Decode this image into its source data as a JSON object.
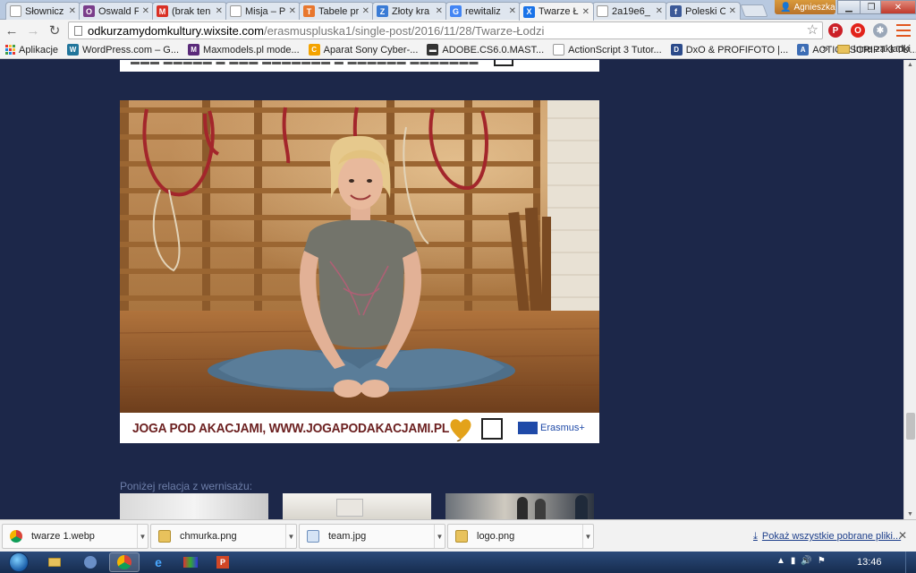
{
  "browser": {
    "tabs": [
      {
        "label": "Słownicz",
        "color": "#ffffff",
        "glyph": ""
      },
      {
        "label": "Oswald F",
        "color": "#7a3d8a",
        "glyph": "O"
      },
      {
        "label": "(brak ten",
        "color": "#d93025",
        "glyph": "M"
      },
      {
        "label": "Misja – P",
        "color": "#ffffff",
        "glyph": ""
      },
      {
        "label": "Tabele pr",
        "color": "#e8772e",
        "glyph": "T"
      },
      {
        "label": "Złoty kra",
        "color": "#3a7bd5",
        "glyph": "Z"
      },
      {
        "label": "rewitaliz",
        "color": "#4285f4",
        "glyph": "G"
      },
      {
        "label": "Twarze Ł",
        "color": "#1a73e8",
        "glyph": "X"
      },
      {
        "label": "2a19e6_",
        "color": "#ffffff",
        "glyph": ""
      },
      {
        "label": "Poleski O",
        "color": "#3b5998",
        "glyph": "f"
      }
    ],
    "active_tab": 7,
    "profile_name": "Agnieszka",
    "url_host": "odkurzamydomkultury.wixsite.com",
    "url_path": "/erasmuspluska1/single-post/2016/11/28/Twarze-Łodzi"
  },
  "bookmarks": {
    "apps_label": "Aplikacje",
    "items": [
      {
        "label": "WordPress.com – G...",
        "color": "#21759b",
        "glyph": "W"
      },
      {
        "label": "Maxmodels.pl mode...",
        "color": "#5a2a7a",
        "glyph": "M"
      },
      {
        "label": "Aparat Sony Cyber-...",
        "color": "#f4a300",
        "glyph": "C"
      },
      {
        "label": "ADOBE.CS6.0.MAST...",
        "color": "#333333",
        "glyph": "▬"
      },
      {
        "label": "ActionScript 3 Tutor...",
        "color": "#ffffff",
        "glyph": ""
      },
      {
        "label": "DxO & PROFIFOTO |...",
        "color": "#2b4a8a",
        "glyph": "D"
      },
      {
        "label": "ACTIONSCRIPT 3 TU...",
        "color": "#3d6db5",
        "glyph": "A"
      }
    ],
    "overflow": "»",
    "other_label": "Inne zakładki"
  },
  "page": {
    "caption": "JOGA POD AKACJAMI, WWW.JOGAPODAKACJAMI.PL",
    "erasmus_label": "Erasmus+",
    "relacja_text": "Poniżej relacja z wernisażu:"
  },
  "downloads": {
    "items": [
      {
        "name": "twarze 1.webp",
        "icon": "chrome"
      },
      {
        "name": "chmurka.png",
        "icon": "image-yellow"
      },
      {
        "name": "team.jpg",
        "icon": "image-blue"
      },
      {
        "name": "logo.png",
        "icon": "image-yellow"
      }
    ],
    "show_all_label": "Pokaż wszystkie pobrane pliki...",
    "close_label": "✕"
  },
  "taskbar": {
    "clock": "13:46"
  },
  "colors": {
    "page_background": "#1c2749",
    "caption_text": "#6b1f1f",
    "erasmus_blue": "#1f4aa8"
  }
}
